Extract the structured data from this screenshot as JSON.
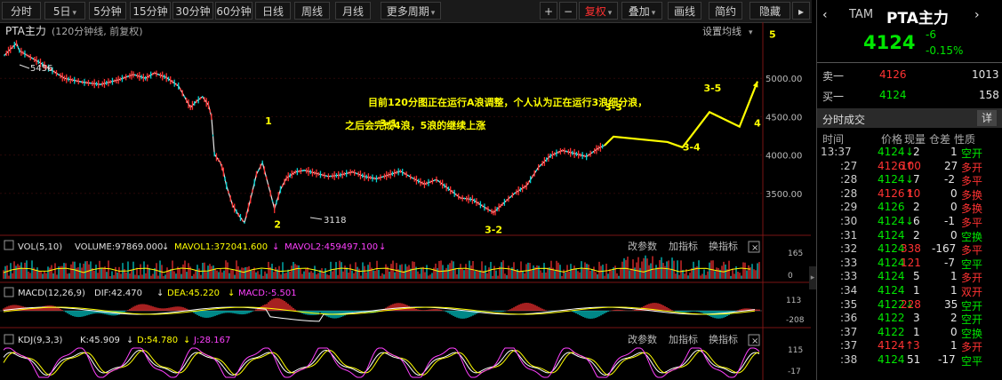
{
  "toolbar": {
    "periods": [
      "分时",
      "5日",
      "5分钟",
      "15分钟",
      "30分钟",
      "60分钟",
      "日线",
      "周线",
      "月线",
      "更多周期"
    ],
    "actions": [
      "+",
      "−",
      "复权",
      "叠加",
      "画线",
      "简约",
      "隐藏"
    ],
    "active_action": "复权"
  },
  "main": {
    "title": "PTA主力",
    "subtitle": "(120分钟线, 前复权)",
    "settings_label": "设置均线",
    "annotation_line1": "目前120分图正在运行A浪调整，个人认为正在运行3浪细分浪，",
    "annotation_line2": "之后会完成4浪，5浪的继续上涨",
    "high_label": "5456",
    "low_label": "3118"
  },
  "wave_labels": [
    {
      "text": "1",
      "x": 88,
      "y": 4400
    },
    {
      "text": "2",
      "x": 91,
      "y": 3050
    },
    {
      "text": "3-1",
      "x": 128,
      "y": 4370
    },
    {
      "text": "3-2",
      "x": 163,
      "y": 2980
    },
    {
      "text": "3-3",
      "x": 203,
      "y": 4580
    },
    {
      "text": "3-4",
      "x": 229,
      "y": 4060
    },
    {
      "text": "3-5",
      "x": 236,
      "y": 4830
    },
    {
      "text": "4",
      "x": 251,
      "y": 4370
    },
    {
      "text": "5",
      "x": 256,
      "y": 5530
    }
  ],
  "chart_data": [
    {
      "type": "line",
      "name": "price",
      "ylim": [
        3000,
        5500
      ],
      "ytick_labels": [
        "5000.00",
        "4500.00",
        "4000.00",
        "3500.00"
      ],
      "yticks": [
        5000,
        4500,
        4000,
        3500
      ],
      "x": [
        0,
        2,
        4,
        5,
        8,
        12,
        16,
        20,
        26,
        32,
        38,
        43,
        47,
        50,
        54,
        58,
        62,
        64,
        66,
        68,
        69,
        70,
        72,
        73,
        74,
        76,
        78,
        80,
        82,
        84,
        86,
        88,
        90,
        92,
        94,
        97,
        100,
        104,
        108,
        112,
        116,
        120,
        124,
        128,
        132,
        136,
        140,
        144,
        148,
        152,
        156,
        160,
        163,
        166,
        170,
        174,
        178,
        182,
        186,
        190,
        194,
        198,
        200
      ],
      "y": [
        5300,
        5380,
        5456,
        5360,
        5290,
        5200,
        5100,
        5000,
        4950,
        4920,
        4980,
        5050,
        5000,
        5070,
        5010,
        4900,
        4620,
        4700,
        4760,
        4650,
        4500,
        4010,
        3900,
        3780,
        3600,
        3350,
        3220,
        3118,
        3420,
        3750,
        3900,
        3600,
        3300,
        3550,
        3700,
        3780,
        3800,
        3760,
        3720,
        3740,
        3780,
        3720,
        3690,
        3740,
        3790,
        3700,
        3620,
        3680,
        3560,
        3440,
        3420,
        3320,
        3250,
        3360,
        3500,
        3600,
        3840,
        3990,
        4060,
        4020,
        3980,
        4090,
        4124
      ],
      "projection_x": [
        200,
        203,
        221,
        226,
        235,
        245,
        251
      ],
      "projection_y": [
        4124,
        4240,
        4170,
        4100,
        4560,
        4370,
        4960
      ]
    },
    {
      "type": "bar",
      "name": "VOL",
      "header_label": "VOL(5,10)",
      "volume_text": "VOLUME:97869.000",
      "mavol1_text": "MAVOL1:372041.600",
      "mavol2_text": "MAVOL2:459497.100",
      "ylim": [
        0,
        200
      ],
      "ytick_labels": [
        "165",
        "0"
      ],
      "yticks": [
        165,
        0
      ]
    },
    {
      "type": "line",
      "name": "MACD",
      "header_label": "MACD(12,26,9)",
      "dif_text": "DIF:42.470",
      "dea_text": "DEA:45.220",
      "macd_text": "MACD:-5.501",
      "ylim": [
        -220,
        140
      ],
      "ytick_labels": [
        "113",
        "-208"
      ],
      "yticks": [
        113,
        -208
      ]
    },
    {
      "type": "line",
      "name": "KDJ",
      "header_label": "KDJ(9,3,3)",
      "k_text": "K:45.909",
      "d_text": "D:54.780",
      "j_text": "J:28.167",
      "ylim": [
        -30,
        130
      ],
      "ytick_labels": [
        "115",
        "-17"
      ],
      "yticks": [
        115,
        -17
      ]
    }
  ],
  "panel_buttons": [
    "改参数",
    "加指标",
    "换指标"
  ],
  "panel_close": "×",
  "quote": {
    "exchange": "TAM",
    "name": "PTA主力",
    "price": "4124",
    "change": "-6",
    "change_pct": "-0.15%",
    "ask_label": "卖一",
    "ask_price": "4126",
    "ask_vol": "1013",
    "bid_label": "买一",
    "bid_price": "4124",
    "bid_vol": "158",
    "ticks_title": "分时成交",
    "ticks_detail": "详",
    "col_headers": [
      "时间",
      "价格",
      "现量",
      "仓差",
      "性质"
    ],
    "ticks": [
      {
        "time": "13:37",
        "price": "4124",
        "arrow": "↓",
        "vol": "2",
        "oi": "1",
        "nature": "空开"
      },
      {
        "time": ":27",
        "price": "4126",
        "arrow": "↑",
        "vol": "100",
        "oi": "27",
        "nature": "多开"
      },
      {
        "time": ":28",
        "price": "4124",
        "arrow": "↓",
        "vol": "7",
        "oi": "-2",
        "nature": "多平"
      },
      {
        "time": ":28",
        "price": "4126",
        "arrow": "↑",
        "vol": "10",
        "oi": "0",
        "nature": "多换"
      },
      {
        "time": ":29",
        "price": "4126",
        "arrow": "",
        "vol": "2",
        "oi": "0",
        "nature": "多换"
      },
      {
        "time": ":30",
        "price": "4124",
        "arrow": "↓",
        "vol": "6",
        "oi": "-1",
        "nature": "多平"
      },
      {
        "time": ":31",
        "price": "4124",
        "arrow": "",
        "vol": "2",
        "oi": "0",
        "nature": "空换"
      },
      {
        "time": ":32",
        "price": "4124",
        "arrow": "",
        "vol": "338",
        "oi": "-167",
        "nature": "多平"
      },
      {
        "time": ":33",
        "price": "4124",
        "arrow": "",
        "vol": "121",
        "oi": "-7",
        "nature": "空平"
      },
      {
        "time": ":33",
        "price": "4124",
        "arrow": "",
        "vol": "5",
        "oi": "1",
        "nature": "多开"
      },
      {
        "time": ":34",
        "price": "4124",
        "arrow": "",
        "vol": "1",
        "oi": "1",
        "nature": "双开"
      },
      {
        "time": ":35",
        "price": "4122",
        "arrow": "↓",
        "vol": "228",
        "oi": "35",
        "nature": "空开"
      },
      {
        "time": ":36",
        "price": "4122",
        "arrow": "",
        "vol": "3",
        "oi": "2",
        "nature": "空开"
      },
      {
        "time": ":37",
        "price": "4122",
        "arrow": "",
        "vol": "1",
        "oi": "0",
        "nature": "空换"
      },
      {
        "time": ":37",
        "price": "4124",
        "arrow": "↑",
        "vol": "3",
        "oi": "1",
        "nature": "多开"
      },
      {
        "time": ":38",
        "price": "4124",
        "arrow": "",
        "vol": "51",
        "oi": "-17",
        "nature": "空平"
      }
    ]
  },
  "colors": {
    "up": "#ff3232",
    "down": "#00d2d2",
    "price_line": "#e8e8e8",
    "projection": "#ffff00",
    "annotation": "#ffff00",
    "green": "#00e600"
  }
}
